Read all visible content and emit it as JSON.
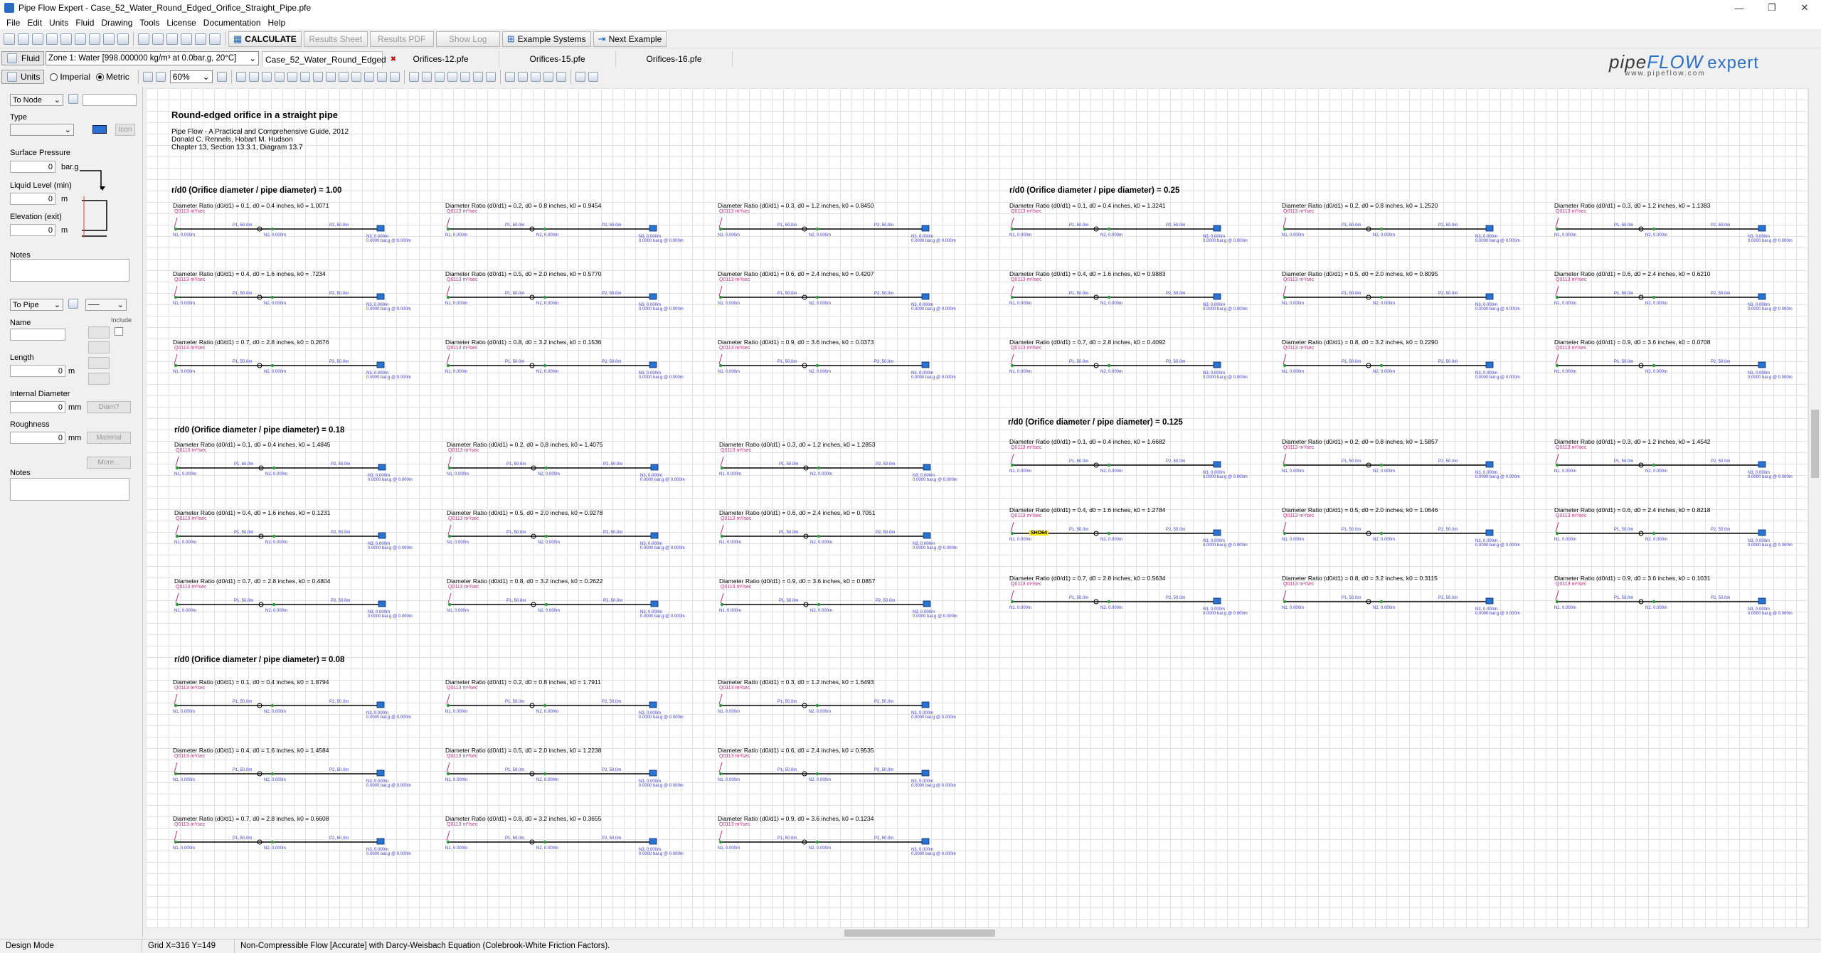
{
  "window": {
    "title": "Pipe Flow Expert - Case_52_Water_Round_Edged_Orifice_Straight_Pipe.pfe",
    "controls": [
      "—",
      "❐",
      "✕"
    ]
  },
  "menu": [
    "File",
    "Edit",
    "Units",
    "Fluid",
    "Drawing",
    "Tools",
    "License",
    "Documentation",
    "Help"
  ],
  "toolbar": {
    "calculate": "CALCULATE",
    "results_sheet": "Results Sheet",
    "results_pdf": "Results PDF",
    "show_log": "Show Log",
    "example_systems": "Example Systems",
    "next_example": "Next Example"
  },
  "fluid_bar": {
    "fluid_button": "Fluid",
    "zone": "Zone 1: Water [998.000000 kg/m³ at 0.0bar.g, 20°C]",
    "tabs": [
      "Case_52_Water_Round_Edged",
      "Orifices-12.pfe",
      "Orifices-15.pfe",
      "Orifices-16.pfe"
    ]
  },
  "logo": {
    "pipe": "pipe",
    "flow": "FLOW",
    "expert": "expert",
    "url": "www.pipeflow.com"
  },
  "units_bar": {
    "units": "Units",
    "imperial": "Imperial",
    "metric": "Metric",
    "zoom": "60%",
    "selected": "metric"
  },
  "left_panel": {
    "to_node": "To Node",
    "type": "Type",
    "icon_btn": "Icon",
    "surface_pressure": "Surface Pressure",
    "surface_pressure_val": "0",
    "surface_pressure_unit": "bar.g",
    "liquid_level": "Liquid Level (min)",
    "liquid_level_val": "0",
    "liquid_level_unit": "m",
    "elevation": "Elevation (exit)",
    "elevation_val": "0",
    "elevation_unit": "m",
    "notes": "Notes",
    "to_pipe": "To Pipe",
    "name": "Name",
    "include": "Include",
    "length": "Length",
    "length_val": "0",
    "length_unit": "m",
    "internal_diameter": "Internal Diameter",
    "internal_diameter_val": "0",
    "internal_diameter_unit": "mm",
    "diam_btn": "Diam?",
    "roughness": "Roughness",
    "roughness_val": "0",
    "roughness_unit": "mm",
    "material_btn": "Material",
    "more_btn": "More...",
    "notes2": "Notes"
  },
  "drawing": {
    "title": "Round-edged orifice in a straight pipe",
    "ref1": "Pipe Flow - A Practical and Comprehensive Guide, 2012",
    "ref2": "Donald C. Rennels, Hobart M. Hudson",
    "ref3": "Chapter 13, Section 13.3.1, Diagram 13.7",
    "flow_label": "Q0113 m³/sec",
    "sections": [
      {
        "title": "r/d0 (Orifice diameter / pipe diameter) = 1.00",
        "captions": [
          "Diameter Ratio (d0/d1) = 0.1, d0 = 0.4 inches, k0 = 1.0071",
          "Diameter Ratio (d0/d1) = 0.2, d0 = 0.8 inches, k0 = 0.9454",
          "Diameter Ratio (d0/d1) = 0.3, d0 = 1.2 inches, k0 = 0.8450",
          "Diameter Ratio (d0/d1) = 0.4, d0 = 1.6 inches, k0 = .7234",
          "Diameter Ratio (d0/d1) = 0.5, d0 = 2.0 inches, k0 = 0.5770",
          "Diameter Ratio (d0/d1) = 0.6, d0 = 2.4 inches, k0 = 0.4207",
          "Diameter Ratio (d0/d1) = 0.7, d0 = 2.8 inches, k0 = 0.2676",
          "Diameter Ratio (d0/d1) = 0.8, d0 = 3.2 inches, k0 = 0.1536",
          "Diameter Ratio (d0/d1) = 0.9, d0 = 3.6 inches, k0 = 0.0373"
        ]
      },
      {
        "title": "r/d0 (Orifice diameter / pipe diameter) = 0.25",
        "captions": [
          "Diameter Ratio (d0/d1) = 0.1, d0 = 0.4 inches, k0 = 1.3241",
          "Diameter Ratio (d0/d1) = 0.2, d0 = 0.8 inches, k0 = 1.2520",
          "Diameter Ratio (d0/d1) = 0.3, d0 = 1.2 inches, k0 = 1.1383",
          "Diameter Ratio (d0/d1) = 0.4, d0 = 1.6 inches, k0 = 0.9883",
          "Diameter Ratio (d0/d1) = 0.5, d0 = 2.0 inches, k0 = 0.8095",
          "Diameter Ratio (d0/d1) = 0.6, d0 = 2.4 inches, k0 = 0.6210",
          "Diameter Ratio (d0/d1) = 0.7, d0 = 2.8 inches, k0 = 0.4092",
          "Diameter Ratio (d0/d1) = 0.8, d0 = 3.2 inches, k0 = 0.2290",
          "Diameter Ratio (d0/d1) = 0.9, d0 = 3.6 inches, k0 = 0.0708"
        ]
      },
      {
        "title": "r/d0 (Orifice diameter / pipe diameter) = 0.18",
        "captions": [
          "Diameter Ratio (d0/d1) = 0.1, d0 = 0.4 inches, k0 = 1.4845",
          "Diameter Ratio (d0/d1) = 0.2, d0 = 0.8 inches, k0 = 1.4075",
          "Diameter Ratio (d0/d1) = 0.3, d0 = 1.2 inches, k0 = 1.2853",
          "Diameter Ratio (d0/d1) = 0.4, d0 = 1.6 inches, k0 = 0.1231",
          "Diameter Ratio (d0/d1) = 0.5, d0 = 2.0 inches, k0 = 0.9278",
          "Diameter Ratio (d0/d1) = 0.6, d0 = 2.4 inches, k0 = 0.7051",
          "Diameter Ratio (d0/d1) = 0.7, d0 = 2.8 inches, k0 = 0.4804",
          "Diameter Ratio (d0/d1) = 0.8, d0 = 3.2 inches, k0 = 0.2622",
          "Diameter Ratio (d0/d1) = 0.9, d0 = 3.6 inches, k0 = 0.0857"
        ]
      },
      {
        "title": "r/d0 (Orifice diameter / pipe diameter) = 0.125",
        "captions": [
          "Diameter Ratio (d0/d1) = 0.1, d0 = 0.4 inches, k0 = 1.6682",
          "Diameter Ratio (d0/d1) = 0.2, d0 = 0.8 inches, k0 = 1.5857",
          "Diameter Ratio (d0/d1) = 0.3, d0 = 1.2 inches, k0 = 1.4542",
          "Diameter Ratio (d0/d1) = 0.4, d0 = 1.6 inches, k0 = 1.2784",
          "Diameter Ratio (d0/d1) = 0.5, d0 = 2.0 inches, k0 = 1.0646",
          "Diameter Ratio (d0/d1) = 0.6, d0 = 2.4 inches, k0 = 0.8218",
          "Diameter Ratio (d0/d1) = 0.7, d0 = 2.8 inches, k0 = 0.5634",
          "Diameter Ratio (d0/d1) = 0.8, d0 = 3.2 inches, k0 = 0.3115",
          "Diameter Ratio (d0/d1) = 0.9, d0 = 3.6 inches, k0 = 0.1031"
        ]
      },
      {
        "title": "r/d0 (Orifice diameter / pipe diameter) = 0.08",
        "captions": [
          "Diameter Ratio (d0/d1) = 0.1, d0 = 0.4 inches, k0 = 1.8794",
          "Diameter Ratio (d0/d1) = 0.2, d0 = 0.8 inches, k0 = 1.7911",
          "Diameter Ratio (d0/d1) = 0.3, d0 = 1.2 inches, k0 = 1.6493",
          "Diameter Ratio (d0/d1) = 0.4, d0 = 1.6 inches, k0 = 1.4584",
          "Diameter Ratio (d0/d1) = 0.5, d0 = 2.0 inches, k0 = 1.2238",
          "Diameter Ratio (d0/d1) = 0.6, d0 = 2.4 inches, k0 = 0.9535",
          "Diameter Ratio (d0/d1) = 0.7, d0 = 2.8 inches, k0 = 0.6608",
          "Diameter Ratio (d0/d1) = 0.8, d0 = 3.2 inches, k0 = 0.3655",
          "Diameter Ratio (d0/d1) = 0.9, d0 = 3.6 inches, k0 = 0.1234"
        ]
      }
    ],
    "highlight_label": "SHO64"
  },
  "status": {
    "mode": "Design Mode",
    "grid": "Grid  X=316  Y=149",
    "message": "Non-Compressible Flow [Accurate] with Darcy-Weisbach Equation (Colebrook-White Friction Factors)."
  }
}
